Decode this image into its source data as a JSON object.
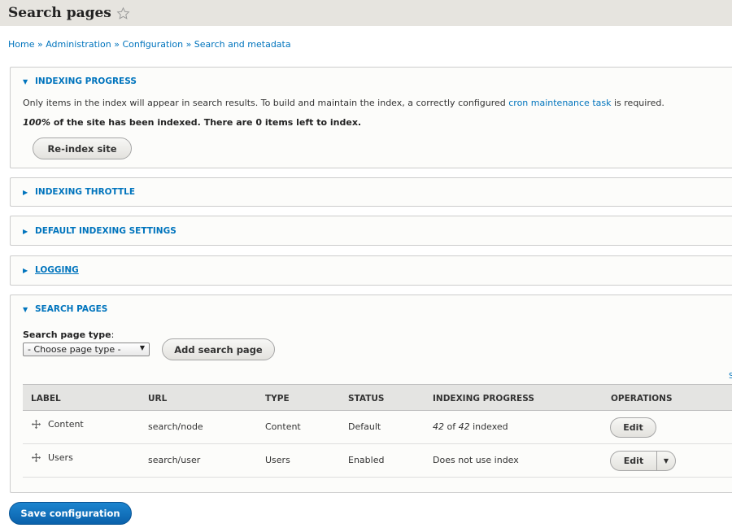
{
  "page": {
    "title": "Search pages",
    "star_icon": "star-outline-icon"
  },
  "breadcrumb": {
    "items": [
      "Home",
      "Administration",
      "Configuration",
      "Search and metadata"
    ],
    "separator": "»"
  },
  "indexing_progress": {
    "title": "INDEXING PROGRESS",
    "expanded": true,
    "description_before": "Only items in the index will appear in search results. To build and maintain the index, a correctly configured ",
    "description_link": "cron maintenance task",
    "description_after": " is required.",
    "percent": "100%",
    "status_text": " of the site has been indexed. There are 0 items left to index.",
    "reindex_button": "Re-index site"
  },
  "sections": {
    "throttle": "INDEXING THROTTLE",
    "default_settings": "DEFAULT INDEXING SETTINGS",
    "logging": "LOGGING"
  },
  "search_pages": {
    "title": "SEARCH PAGES",
    "page_type_label": "Search page type",
    "page_type_colon": ":",
    "select_value": "- Choose page type -",
    "add_button": "Add search page",
    "cutoff_text": "S",
    "columns": [
      "LABEL",
      "URL",
      "TYPE",
      "STATUS",
      "INDEXING PROGRESS",
      "OPERATIONS"
    ],
    "rows": [
      {
        "label": "Content",
        "url": "search/node",
        "type": "Content",
        "status": "Default",
        "progress_indexed": "42",
        "progress_of": " of ",
        "progress_total": "42",
        "progress_suffix": " indexed",
        "operation": "Edit"
      },
      {
        "label": "Users",
        "url": "search/user",
        "type": "Users",
        "status": "Enabled",
        "progress_text": "Does not use index",
        "operation": "Edit"
      }
    ]
  },
  "footer": {
    "save_button": "Save configuration"
  },
  "colors": {
    "link": "#0074bd",
    "header_bg": "#e6e4df",
    "primary_button": "#0a61ab"
  }
}
